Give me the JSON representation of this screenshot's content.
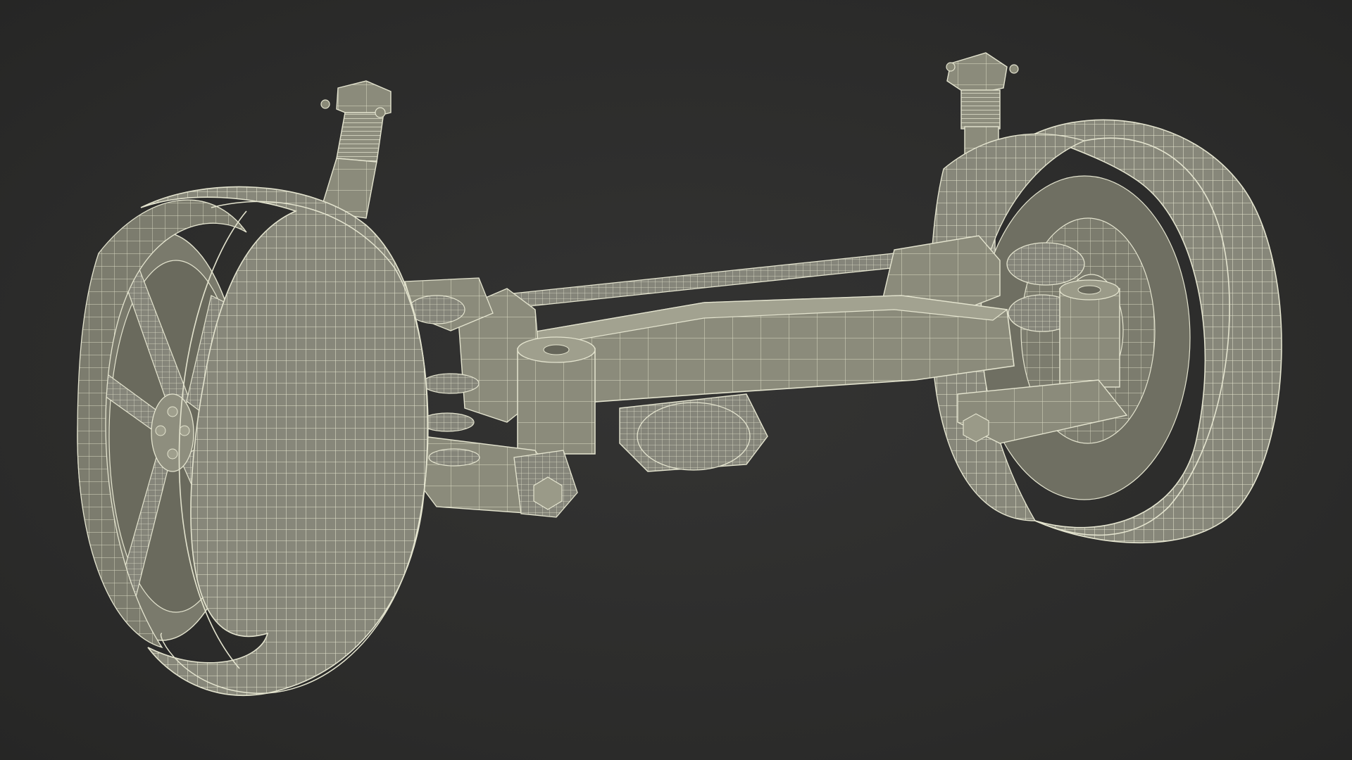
{
  "scene": {
    "subject": "wireframe-render",
    "colors": {
      "background": "#2d2d2c",
      "surface": "#8a8a78",
      "surface_dark": "#6f6f60",
      "surface_light": "#a3a391",
      "wire": "#e4e4cf",
      "shadow": "#55554a"
    }
  }
}
